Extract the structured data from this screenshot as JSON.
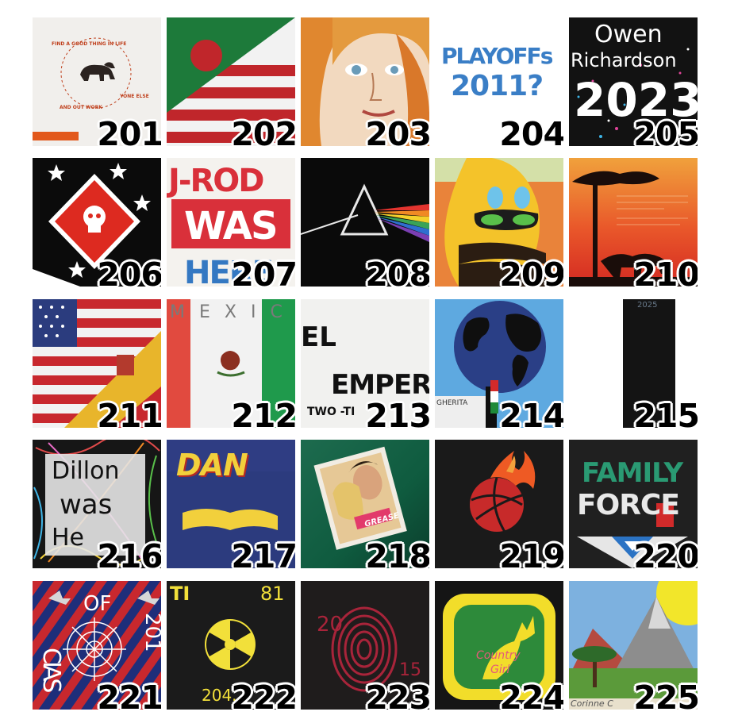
{
  "tiles": [
    {
      "number": "201",
      "text": [
        "FIND A GOOD THING IN LIFE",
        "AND OUT WORK",
        "YONE ELSE"
      ]
    },
    {
      "number": "202"
    },
    {
      "number": "203"
    },
    {
      "number": "204",
      "text": [
        "PLAYOFFs",
        "2011?"
      ]
    },
    {
      "number": "205",
      "text": [
        "Owen",
        "Richardson",
        "2023"
      ]
    },
    {
      "number": "206"
    },
    {
      "number": "207",
      "text": [
        "J-ROD",
        "WAS",
        "HERE"
      ]
    },
    {
      "number": "208"
    },
    {
      "number": "209"
    },
    {
      "number": "210"
    },
    {
      "number": "211"
    },
    {
      "number": "212",
      "text": [
        "MEXICO"
      ]
    },
    {
      "number": "213",
      "text": [
        "EL",
        "EMPERO",
        "TWO -TI"
      ]
    },
    {
      "number": "214",
      "text": [
        "GHERITA"
      ]
    },
    {
      "number": "215",
      "text": [
        "2025"
      ]
    },
    {
      "number": "216",
      "text": [
        "Dillon",
        "was",
        "He"
      ]
    },
    {
      "number": "217",
      "text": [
        "DAN"
      ]
    },
    {
      "number": "218",
      "text": [
        "GREASE"
      ]
    },
    {
      "number": "219"
    },
    {
      "number": "220",
      "text": [
        "FAMILY",
        "FORCE"
      ]
    },
    {
      "number": "221",
      "text": [
        "CIAS",
        "OF",
        "201"
      ]
    },
    {
      "number": "222",
      "text": [
        "TI",
        "81",
        "204."
      ]
    },
    {
      "number": "223",
      "text": [
        "20",
        "15"
      ]
    },
    {
      "number": "224",
      "text": [
        "Country",
        "Girl"
      ]
    },
    {
      "number": "225",
      "text": [
        "Corinne C"
      ]
    }
  ]
}
